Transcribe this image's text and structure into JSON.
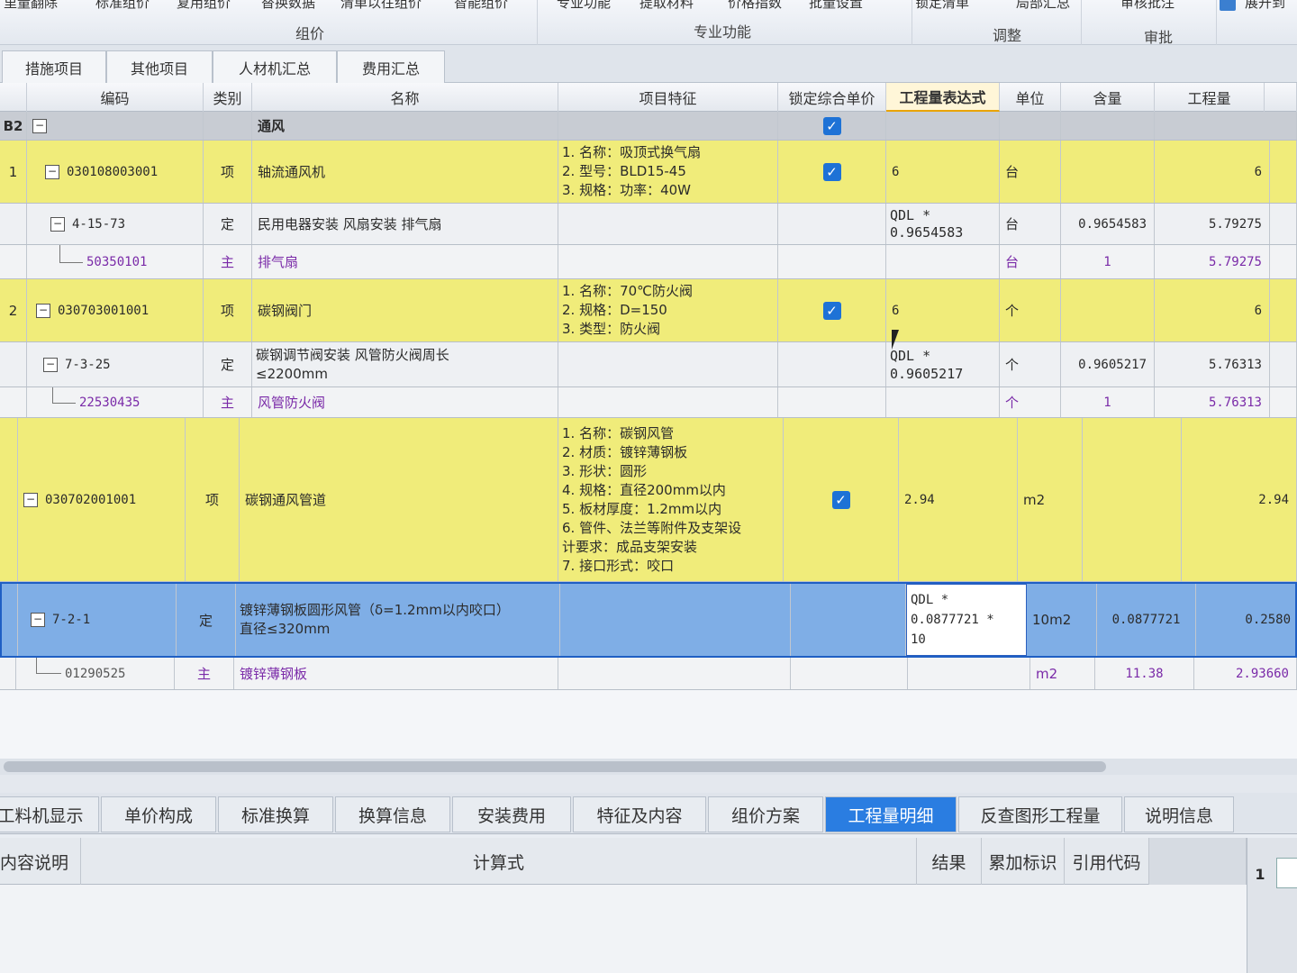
{
  "ribbon": {
    "buttons": [
      "里量翻除",
      "标准组价",
      "复用组价",
      "替换数据",
      "清单以往组价",
      "智能组价",
      "专业功能",
      "提取材料",
      "价格指数",
      "批量设置",
      "锁定清单",
      "局部汇总",
      "审核批注",
      "展开到"
    ],
    "groups": {
      "zujia": "组价",
      "zhuanye": "专业功能",
      "tiaozheng": "调整",
      "shenpi": "审批"
    }
  },
  "top_tabs": [
    "措施项目",
    "其他项目",
    "人材机汇总",
    "费用汇总"
  ],
  "columns": {
    "code": "编码",
    "type": "类别",
    "name": "名称",
    "feature": "项目特征",
    "lock": "锁定综合单价",
    "expr": "工程量表达式",
    "unit": "单位",
    "content": "含量",
    "qty": "工程量"
  },
  "rows": [
    {
      "kind": "section",
      "rownum": "B2",
      "code": "",
      "type": "",
      "name": "通风",
      "feature": [],
      "checked": true,
      "expr": [],
      "unit": "",
      "content": "",
      "qty": ""
    },
    {
      "kind": "item",
      "rownum": "1",
      "code": "030108003001",
      "type": "项",
      "name": [
        "轴流通风机"
      ],
      "feature": [
        "1. 名称：吸顶式换气扇",
        "2. 型号：BLD15-45",
        "3. 规格：功率：40W"
      ],
      "checked": true,
      "expr": [
        "6"
      ],
      "unit": "台",
      "content": "",
      "qty": "6"
    },
    {
      "kind": "norm",
      "rownum": "",
      "code": "4-15-73",
      "type": "定",
      "name": [
        "民用电器安装 风扇安装 排气扇"
      ],
      "feature": [],
      "checked": false,
      "expr": [
        "QDL *",
        "0.9654583"
      ],
      "unit": "台",
      "content": "0.9654583",
      "qty": "5.79275"
    },
    {
      "kind": "mat",
      "rownum": "",
      "code": "50350101",
      "type": "主",
      "name": [
        "排气扇"
      ],
      "feature": [],
      "checked": false,
      "expr": [],
      "unit": "台",
      "content": "1",
      "qty": "5.79275"
    },
    {
      "kind": "item",
      "rownum": "2",
      "code": "030703001001",
      "type": "项",
      "name": [
        "碳钢阀门"
      ],
      "feature": [
        "1. 名称：70℃防火阀",
        "2. 规格：D=150",
        "3. 类型：防火阀"
      ],
      "checked": true,
      "expr": [
        "6"
      ],
      "unit": "个",
      "content": "",
      "qty": "6"
    },
    {
      "kind": "norm",
      "rownum": "",
      "code": "7-3-25",
      "type": "定",
      "name": [
        "碳钢调节阀安装 风管防火阀周长",
        "≤2200mm"
      ],
      "feature": [],
      "checked": false,
      "expr": [
        "QDL *",
        "0.9605217"
      ],
      "unit": "个",
      "content": "0.9605217",
      "qty": "5.76313"
    },
    {
      "kind": "mat",
      "rownum": "",
      "code": "22530435",
      "type": "主",
      "name": [
        "风管防火阀"
      ],
      "feature": [],
      "checked": false,
      "expr": [],
      "unit": "个",
      "content": "1",
      "qty": "5.76313"
    },
    {
      "kind": "item",
      "rownum": "",
      "code": "030702001001",
      "type": "项",
      "name": [
        "碳钢通风管道"
      ],
      "feature": [
        "1. 名称：碳钢风管",
        "2. 材质：镀锌薄钢板",
        "3. 形状：圆形",
        "4. 规格：直径200mm以内",
        "5. 板材厚度：1.2mm以内",
        "6. 管件、法兰等附件及支架设",
        "计要求：成品支架安装",
        "7. 接口形式：咬口"
      ],
      "checked": true,
      "expr": [
        "2.94"
      ],
      "unit": "m2",
      "content": "",
      "qty": "2.94"
    },
    {
      "kind": "selected",
      "rownum": "",
      "code": "7-2-1",
      "type": "定",
      "name": [
        "镀锌薄钢板圆形风管（δ=1.2mm以内咬口）",
        "直径≤320mm"
      ],
      "feature": [],
      "checked": false,
      "expr": [
        "QDL *",
        "0.0877721 *",
        "10"
      ],
      "unit": "10m2",
      "content": "0.0877721",
      "qty": "0.2580"
    },
    {
      "kind": "mat",
      "rownum": "",
      "code": "01290525",
      "type": "主",
      "name": [
        "镀锌薄钢板"
      ],
      "feature": [],
      "checked": false,
      "expr": [],
      "unit": "m2",
      "content": "11.38",
      "qty": "2.93660"
    }
  ],
  "bottom_tabs": [
    "工料机显示",
    "单价构成",
    "标准换算",
    "换算信息",
    "安装费用",
    "特征及内容",
    "组价方案",
    "工程量明细",
    "反查图形工程量",
    "说明信息"
  ],
  "bottom_active": "工程量明细",
  "bottom_columns": {
    "desc": "内容说明",
    "formula": "计算式",
    "result": "结果",
    "acc": "累加标识",
    "ref": "引用代码"
  },
  "bottom_row_num": "1"
}
